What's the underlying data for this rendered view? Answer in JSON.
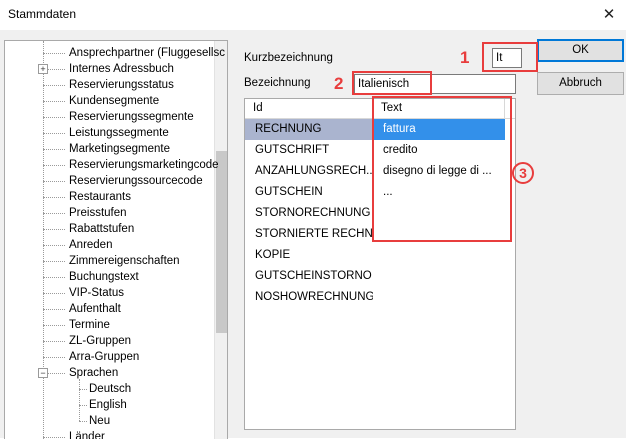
{
  "window": {
    "title": "Stammdaten"
  },
  "tree": {
    "items": [
      {
        "label": "Ansprechpartner (Fluggesellsc"
      },
      {
        "label": "Internes Adressbuch",
        "expander": "+"
      },
      {
        "label": "Reservierungsstatus"
      },
      {
        "label": "Kundensegmente"
      },
      {
        "label": "Reservierungssegmente"
      },
      {
        "label": "Leistungssegmente"
      },
      {
        "label": "Marketingsegmente"
      },
      {
        "label": "Reservierungsmarketingcode"
      },
      {
        "label": "Reservierungssourcecode"
      },
      {
        "label": "Restaurants"
      },
      {
        "label": "Preisstufen"
      },
      {
        "label": "Rabattstufen"
      },
      {
        "label": "Anreden"
      },
      {
        "label": "Zimmereigenschaften"
      },
      {
        "label": "Buchungstext"
      },
      {
        "label": "VIP-Status"
      },
      {
        "label": "Aufenthalt"
      },
      {
        "label": "Termine"
      },
      {
        "label": "ZL-Gruppen"
      },
      {
        "label": "Arra-Gruppen"
      },
      {
        "label": "Sprachen",
        "expander": "−"
      },
      {
        "label": "Deutsch",
        "child": true
      },
      {
        "label": "English",
        "child": true
      },
      {
        "label": "Neu",
        "child": true
      },
      {
        "label": "Länder"
      }
    ]
  },
  "form": {
    "kurz_label": "Kurzbezeichnung",
    "kurz_value": "It",
    "bez_label": "Bezeichnung",
    "bez_value": "Italienisch"
  },
  "buttons": {
    "ok": "OK",
    "cancel": "Abbruch"
  },
  "grid": {
    "columns": [
      "Id",
      "Text"
    ],
    "rows": [
      {
        "id": "RECHNUNG",
        "text": "fattura",
        "selected": true
      },
      {
        "id": "GUTSCHRIFT",
        "text": "credito"
      },
      {
        "id": "ANZAHLUNGSRECH...",
        "text": "disegno di legge di ..."
      },
      {
        "id": "GUTSCHEIN",
        "text": "..."
      },
      {
        "id": "STORNORECHNUNG",
        "text": ""
      },
      {
        "id": "STORNIERTE RECHN...",
        "text": ""
      },
      {
        "id": "KOPIE",
        "text": ""
      },
      {
        "id": "GUTSCHEINSTORNO",
        "text": ""
      },
      {
        "id": "NOSHOWRECHNUNG",
        "text": ""
      }
    ]
  },
  "callouts": [
    "1",
    "2",
    "3"
  ],
  "colors": {
    "callout": "#e83d3d",
    "selection": "#3390ea",
    "selection_inactive": "#aab4cf",
    "default_button_border": "#0078d7"
  }
}
